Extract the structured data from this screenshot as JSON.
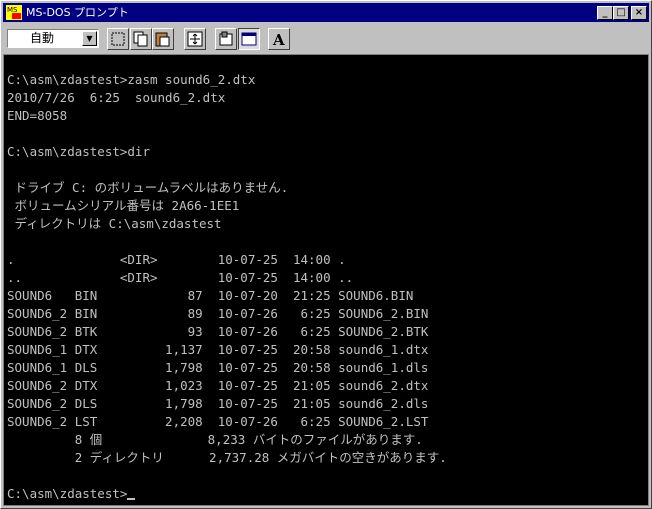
{
  "window": {
    "title": "MS-DOS プロンプト",
    "icon": "ms-dos-app-icon",
    "controls": {
      "minimize": "_",
      "maximize": "□",
      "close": "×"
    }
  },
  "toolbar": {
    "font_select_value": "自動",
    "tools": [
      "mark-icon",
      "copy-icon",
      "paste-icon",
      "fullscreen-icon",
      "properties-icon",
      "background-icon",
      "font-icon"
    ],
    "font_tool_glyph": "A"
  },
  "console": {
    "lines": [
      "C:\\asm\\zdastest>zasm sound6_2.dtx",
      "2010/7/26  6:25  sound6_2.dtx",
      "END=8058",
      "",
      "C:\\asm\\zdastest>dir",
      "",
      " ドライブ C: のボリュームラベルはありません.",
      " ボリュームシリアル番号は 2A66-1EE1",
      " ディレクトリは C:\\asm\\zdastest",
      "",
      ".              <DIR>        10-07-25  14:00 .",
      "..             <DIR>        10-07-25  14:00 ..",
      "SOUND6   BIN            87  10-07-20  21:25 SOUND6.BIN",
      "SOUND6_2 BIN            89  10-07-26   6:25 SOUND6_2.BIN",
      "SOUND6_2 BTK            93  10-07-26   6:25 SOUND6_2.BTK",
      "SOUND6_1 DTX         1,137  10-07-25  20:58 sound6_1.dtx",
      "SOUND6_1 DLS         1,798  10-07-25  20:58 sound6_1.dls",
      "SOUND6_2 DTX         1,023  10-07-25  21:05 sound6_2.dtx",
      "SOUND6_2 DLS         1,798  10-07-25  21:05 sound6_2.dls",
      "SOUND6_2 LST         2,208  10-07-26   6:25 SOUND6_2.LST",
      "         8 個              8,233 バイトのファイルがあります.",
      "         2 ディレクトリ      2,737.28 メガバイトの空きがあります.",
      "",
      "C:\\asm\\zdastest>"
    ],
    "bg_color": "#000000",
    "fg_color": "#c0c0c0"
  },
  "colors": {
    "titlebar": "#000080",
    "chrome": "#c0c0c0"
  }
}
